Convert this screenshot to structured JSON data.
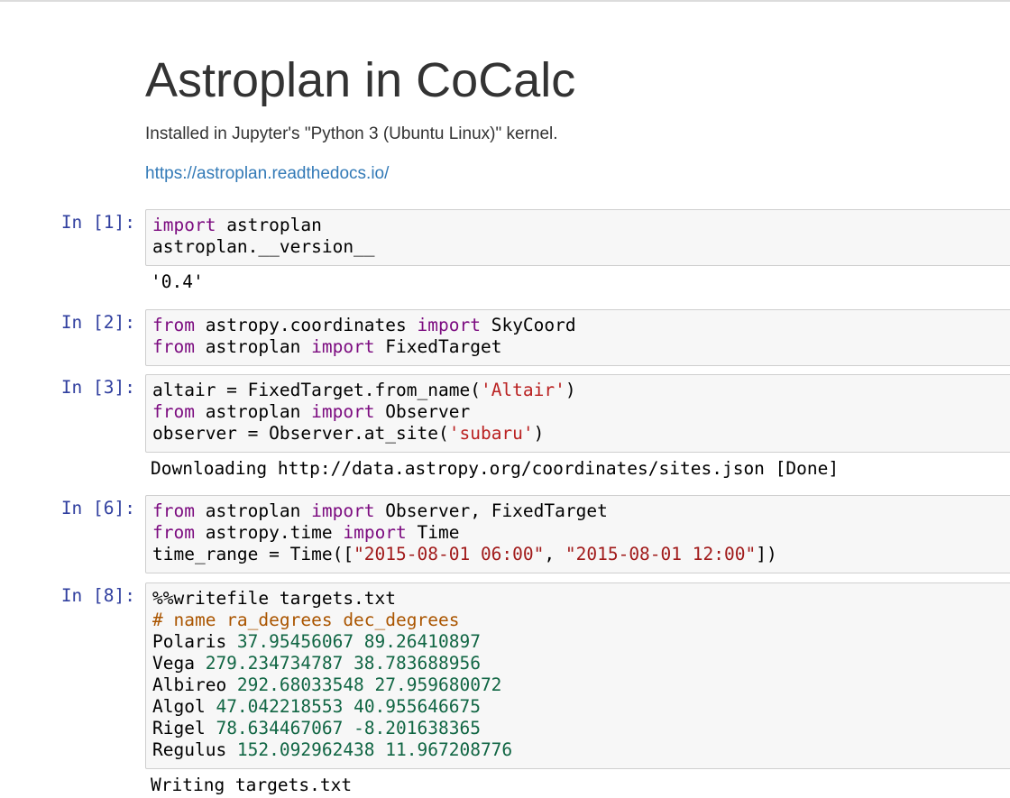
{
  "markdown": {
    "title": "Astroplan in CoCalc",
    "paragraph": "Installed in Jupyter's \"Python 3 (Ubuntu Linux)\" kernel.",
    "link": "https://astroplan.readthedocs.io/"
  },
  "cells": [
    {
      "prompt": "In [1]:",
      "lines": [
        [
          {
            "t": "kw",
            "v": "import"
          },
          {
            "t": "plain",
            "v": " astroplan"
          }
        ],
        [
          {
            "t": "plain",
            "v": "astroplan.__version__"
          }
        ]
      ],
      "output": "'0.4'"
    },
    {
      "prompt": "In [2]:",
      "lines": [
        [
          {
            "t": "kw",
            "v": "from"
          },
          {
            "t": "plain",
            "v": " astropy.coordinates "
          },
          {
            "t": "kw",
            "v": "import"
          },
          {
            "t": "plain",
            "v": " SkyCoord"
          }
        ],
        [
          {
            "t": "kw",
            "v": "from"
          },
          {
            "t": "plain",
            "v": " astroplan "
          },
          {
            "t": "kw",
            "v": "import"
          },
          {
            "t": "plain",
            "v": " FixedTarget"
          }
        ]
      ],
      "output": ""
    },
    {
      "prompt": "In [3]:",
      "lines": [
        [
          {
            "t": "plain",
            "v": "altair = FixedTarget.from_name("
          },
          {
            "t": "str",
            "v": "'Altair'"
          },
          {
            "t": "plain",
            "v": ")"
          }
        ],
        [
          {
            "t": "kw",
            "v": "from"
          },
          {
            "t": "plain",
            "v": " astroplan "
          },
          {
            "t": "kw",
            "v": "import"
          },
          {
            "t": "plain",
            "v": " Observer"
          }
        ],
        [
          {
            "t": "plain",
            "v": "observer = Observer.at_site("
          },
          {
            "t": "str",
            "v": "'subaru'"
          },
          {
            "t": "plain",
            "v": ")"
          }
        ]
      ],
      "output": "Downloading http://data.astropy.org/coordinates/sites.json [Done]"
    },
    {
      "prompt": "In [6]:",
      "lines": [
        [
          {
            "t": "kw",
            "v": "from"
          },
          {
            "t": "plain",
            "v": " astroplan "
          },
          {
            "t": "kw",
            "v": "import"
          },
          {
            "t": "plain",
            "v": " Observer, FixedTarget"
          }
        ],
        [
          {
            "t": "kw",
            "v": "from"
          },
          {
            "t": "plain",
            "v": " astropy.time "
          },
          {
            "t": "kw",
            "v": "import"
          },
          {
            "t": "plain",
            "v": " Time"
          }
        ],
        [
          {
            "t": "plain",
            "v": "time_range = Time(["
          },
          {
            "t": "str2",
            "v": "\"2015-08-01 06:00\""
          },
          {
            "t": "plain",
            "v": ", "
          },
          {
            "t": "str2",
            "v": "\"2015-08-01 12:00\""
          },
          {
            "t": "plain",
            "v": "])"
          }
        ]
      ],
      "output": ""
    },
    {
      "prompt": "In [8]:",
      "lines": [
        [
          {
            "t": "plain",
            "v": "%%writefile targets.txt"
          }
        ],
        [
          {
            "t": "cmt",
            "v": "# name ra_degrees dec_degrees"
          }
        ],
        [
          {
            "t": "plain",
            "v": "Polaris "
          },
          {
            "t": "num",
            "v": "37.95456067 89.26410897"
          }
        ],
        [
          {
            "t": "plain",
            "v": "Vega "
          },
          {
            "t": "num",
            "v": "279.234734787 38.783688956"
          }
        ],
        [
          {
            "t": "plain",
            "v": "Albireo "
          },
          {
            "t": "num",
            "v": "292.68033548 27.959680072"
          }
        ],
        [
          {
            "t": "plain",
            "v": "Algol "
          },
          {
            "t": "num",
            "v": "47.042218553 40.955646675"
          }
        ],
        [
          {
            "t": "plain",
            "v": "Rigel "
          },
          {
            "t": "num",
            "v": "78.634467067 -8.201638365"
          }
        ],
        [
          {
            "t": "plain",
            "v": "Regulus "
          },
          {
            "t": "num",
            "v": "152.092962438 11.967208776"
          }
        ]
      ],
      "output": "Writing targets.txt"
    }
  ],
  "colors": {
    "keyword": "#7c0c80",
    "string": "#ba2121",
    "number": "#116644",
    "comment": "#aa5500",
    "prompt": "#303f9f",
    "link": "#337ab7"
  }
}
